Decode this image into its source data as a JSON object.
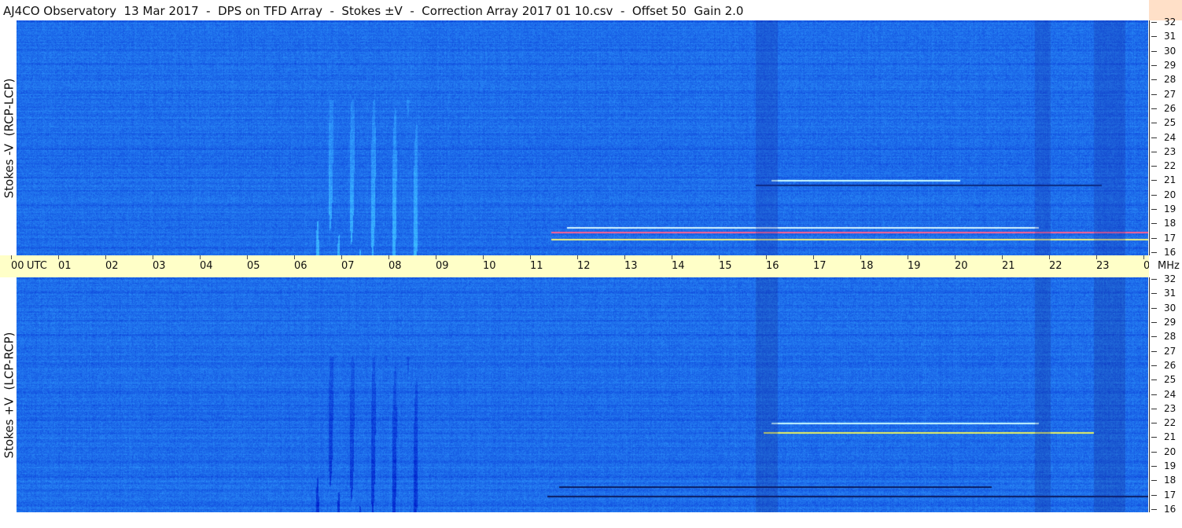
{
  "title": "AJ4CO Observatory  13 Mar 2017  -  DPS on TFD Array  -  Stokes ±V  -  Correction Array 2017 01 10.csv  -  Offset 50  Gain 2.0",
  "panels": {
    "top_label": "Stokes -V  (RCP-LCP)",
    "bottom_label": "Stokes +V  (LCP-RCP)"
  },
  "chart_data": {
    "type": "heatmap",
    "title": "AJ4CO Observatory  13 Mar 2017  -  DPS on TFD Array  -  Stokes ±V  -  Correction Array 2017 01 10.csv  -  Offset 50  Gain 2.0",
    "x_axis": {
      "utc_label": "UTC",
      "ticks": [
        "00",
        "01",
        "02",
        "03",
        "04",
        "05",
        "06",
        "07",
        "08",
        "09",
        "10",
        "11",
        "12",
        "13",
        "14",
        "15",
        "16",
        "17",
        "18",
        "19",
        "20",
        "21",
        "22",
        "23",
        "00"
      ],
      "range_hours": [
        0,
        24
      ]
    },
    "y_axis": {
      "unit": "MHz",
      "ticks": [
        "32",
        "31",
        "30",
        "29",
        "28",
        "27",
        "26",
        "25",
        "24",
        "23",
        "22",
        "21",
        "20",
        "19",
        "18",
        "17",
        "16"
      ],
      "range_mhz": [
        16,
        32
      ]
    },
    "colors": {
      "background": "#1f6fe8",
      "bright": "#4ac8f8",
      "axis_strip": "#ffffc8",
      "freq_strip": "#ffe0c8"
    },
    "series": [
      {
        "name": "Stokes -V  (RCP-LCP)"
      },
      {
        "name": "Stokes +V  (LCP-RCP)"
      }
    ]
  }
}
